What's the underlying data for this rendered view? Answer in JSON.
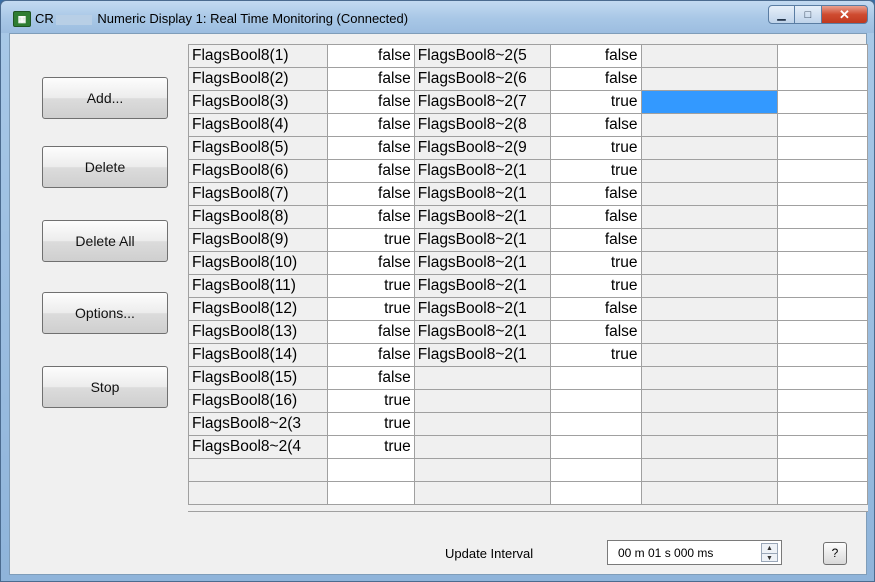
{
  "window": {
    "title_prefix": "CR",
    "title_rest": "Numeric Display 1: Real Time Monitoring (Connected)"
  },
  "buttons": {
    "add": "Add...",
    "delete": "Delete",
    "delete_all": "Delete All",
    "options": "Options...",
    "stop": "Stop"
  },
  "grid": {
    "rows": [
      [
        "FlagsBool8(1)",
        "false",
        "FlagsBool8~2(5",
        "false"
      ],
      [
        "FlagsBool8(2)",
        "false",
        "FlagsBool8~2(6",
        "false"
      ],
      [
        "FlagsBool8(3)",
        "false",
        "FlagsBool8~2(7",
        "true"
      ],
      [
        "FlagsBool8(4)",
        "false",
        "FlagsBool8~2(8",
        "false"
      ],
      [
        "FlagsBool8(5)",
        "false",
        "FlagsBool8~2(9",
        "true"
      ],
      [
        "FlagsBool8(6)",
        "false",
        "FlagsBool8~2(1",
        "true"
      ],
      [
        "FlagsBool8(7)",
        "false",
        "FlagsBool8~2(1",
        "false"
      ],
      [
        "FlagsBool8(8)",
        "false",
        "FlagsBool8~2(1",
        "false"
      ],
      [
        "FlagsBool8(9)",
        "true",
        "FlagsBool8~2(1",
        "false"
      ],
      [
        "FlagsBool8(10)",
        "false",
        "FlagsBool8~2(1",
        "true"
      ],
      [
        "FlagsBool8(11)",
        "true",
        "FlagsBool8~2(1",
        "true"
      ],
      [
        "FlagsBool8(12)",
        "true",
        "FlagsBool8~2(1",
        "false"
      ],
      [
        "FlagsBool8(13)",
        "false",
        "FlagsBool8~2(1",
        "false"
      ],
      [
        "FlagsBool8(14)",
        "false",
        "FlagsBool8~2(1",
        "true"
      ],
      [
        "FlagsBool8(15)",
        "false",
        "",
        ""
      ],
      [
        "FlagsBool8(16)",
        "true",
        "",
        ""
      ],
      [
        "FlagsBool8~2(3",
        "true",
        "",
        ""
      ],
      [
        "FlagsBool8~2(4",
        "true",
        "",
        ""
      ]
    ],
    "selected_row": 2
  },
  "footer": {
    "update_interval_label": "Update Interval",
    "update_interval_value": "00 m 01 s 000 ms",
    "help_label": "?"
  },
  "colors": {
    "selection": "#3399ff"
  }
}
